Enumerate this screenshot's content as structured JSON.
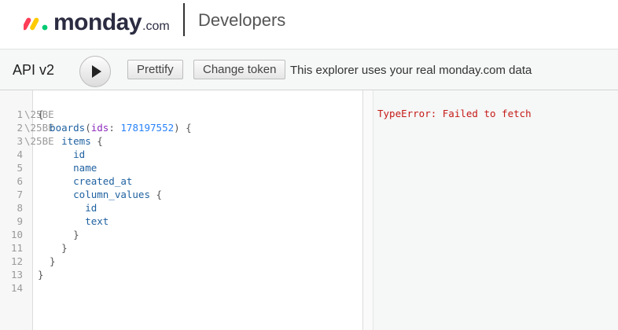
{
  "header": {
    "logo_word": "monday",
    "logo_suffix": ".com",
    "section_title": "Developers"
  },
  "toolbar": {
    "title": "API v2",
    "prettify_label": "Prettify",
    "change_token_label": "Change token",
    "note": "This explorer uses your real monday.com data"
  },
  "editor": {
    "lines": [
      {
        "n": "1",
        "fold": "\\25BE",
        "parts": [
          {
            "t": "{",
            "c": "punc"
          }
        ]
      },
      {
        "n": "2",
        "fold": "\\25BE",
        "parts": [
          {
            "t": "  boards",
            "c": "kw"
          },
          {
            "t": "(",
            "c": "punc"
          },
          {
            "t": "ids",
            "c": "arg"
          },
          {
            "t": ": ",
            "c": "punc"
          },
          {
            "t": "178197552",
            "c": "num"
          },
          {
            "t": ") {",
            "c": "punc"
          }
        ]
      },
      {
        "n": "3",
        "fold": "\\25BE",
        "parts": [
          {
            "t": "    items",
            "c": "kw"
          },
          {
            "t": " {",
            "c": "punc"
          }
        ]
      },
      {
        "n": "4",
        "fold": "",
        "parts": [
          {
            "t": "      id",
            "c": "kw"
          }
        ]
      },
      {
        "n": "5",
        "fold": "",
        "parts": [
          {
            "t": "      name",
            "c": "kw"
          }
        ]
      },
      {
        "n": "6",
        "fold": "",
        "parts": [
          {
            "t": "      created_at",
            "c": "kw"
          }
        ]
      },
      {
        "n": "7",
        "fold": "",
        "parts": [
          {
            "t": "      column_values",
            "c": "kw"
          },
          {
            "t": " {",
            "c": "punc"
          }
        ]
      },
      {
        "n": "8",
        "fold": "",
        "parts": [
          {
            "t": "        id",
            "c": "kw"
          }
        ]
      },
      {
        "n": "9",
        "fold": "",
        "parts": [
          {
            "t": "        text",
            "c": "kw"
          }
        ]
      },
      {
        "n": "10",
        "fold": "",
        "parts": [
          {
            "t": "      }",
            "c": "punc"
          }
        ]
      },
      {
        "n": "11",
        "fold": "",
        "parts": [
          {
            "t": "    }",
            "c": "punc"
          }
        ]
      },
      {
        "n": "12",
        "fold": "",
        "parts": [
          {
            "t": "  }",
            "c": "punc"
          }
        ]
      },
      {
        "n": "13",
        "fold": "",
        "parts": [
          {
            "t": "}",
            "c": "punc"
          }
        ]
      },
      {
        "n": "14",
        "fold": "",
        "parts": []
      }
    ]
  },
  "result": {
    "error": "TypeError: Failed to fetch"
  },
  "colors": {
    "logo_red": "#ff3d57",
    "logo_yellow": "#ffcb00",
    "logo_green": "#00ca72",
    "keyword": "#1f61a0",
    "argument": "#8b2bb9",
    "number": "#2882f9",
    "error": "#c41a16"
  }
}
